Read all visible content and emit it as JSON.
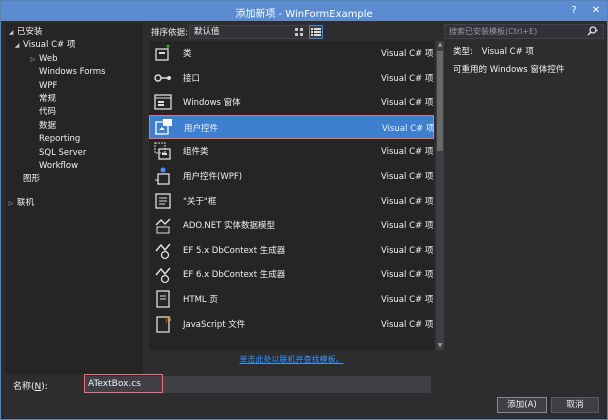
{
  "window": {
    "title": "添加新项 - WinFormExample",
    "help_glyph": "?",
    "close_glyph": "✕"
  },
  "tree": [
    {
      "label": "已安装",
      "level": 0,
      "expanded": true
    },
    {
      "label": "Visual C# 项",
      "level": 1,
      "expanded": true
    },
    {
      "label": "Web",
      "level": 2,
      "expanded": false
    },
    {
      "label": "Windows Forms",
      "level": 2,
      "expanded": null
    },
    {
      "label": "WPF",
      "level": 2,
      "expanded": null
    },
    {
      "label": "常规",
      "level": 2,
      "expanded": null
    },
    {
      "label": "代码",
      "level": 2,
      "expanded": null
    },
    {
      "label": "数据",
      "level": 2,
      "expanded": null
    },
    {
      "label": "Reporting",
      "level": 2,
      "expanded": null
    },
    {
      "label": "SQL Server",
      "level": 2,
      "expanded": null
    },
    {
      "label": "Workflow",
      "level": 2,
      "expanded": null
    },
    {
      "label": "图形",
      "level": 1,
      "expanded": null
    },
    {
      "label": "联机",
      "level": 0,
      "expanded": false
    }
  ],
  "toolbar": {
    "sort_label": "排序依据:",
    "sort_value": "默认值"
  },
  "search": {
    "placeholder": "搜索已安装模板(Ctrl+E)"
  },
  "items": [
    {
      "name": "类",
      "type": "Visual C# 项",
      "icon": "class-icon"
    },
    {
      "name": "接口",
      "type": "Visual C# 项",
      "icon": "interface-icon"
    },
    {
      "name": "Windows 窗体",
      "type": "Visual C# 项",
      "icon": "windows-form-icon"
    },
    {
      "name": "用户控件",
      "type": "Visual C# 项",
      "icon": "user-control-icon",
      "selected": true
    },
    {
      "name": "组件类",
      "type": "Visual C# 项",
      "icon": "component-class-icon"
    },
    {
      "name": "用户控件(WPF)",
      "type": "Visual C# 项",
      "icon": "wpf-user-control-icon"
    },
    {
      "name": "\"关于\"框",
      "type": "Visual C# 项",
      "icon": "about-box-icon"
    },
    {
      "name": "ADO.NET 实体数据模型",
      "type": "Visual C# 项",
      "icon": "entity-model-icon"
    },
    {
      "name": "EF 5.x DbContext 生成器",
      "type": "Visual C# 项",
      "icon": "dbcontext-generator-icon"
    },
    {
      "name": "EF 6.x DbContext 生成器",
      "type": "Visual C# 项",
      "icon": "dbcontext-generator-icon"
    },
    {
      "name": "HTML 页",
      "type": "Visual C# 项",
      "icon": "html-page-icon"
    },
    {
      "name": "JavaScript 文件",
      "type": "Visual C# 项",
      "icon": "javascript-file-icon"
    }
  ],
  "details": {
    "type_label": "类型:",
    "type_value": "Visual C# 项",
    "description": "可重用的 Windows 窗体控件"
  },
  "online_link": "单击此处以联机并查找模板。",
  "name_field": {
    "label": "名称(",
    "label_key": "N",
    "label_end": "):",
    "value": "ATextBox.cs"
  },
  "buttons": {
    "add": "添加(A)",
    "cancel": "取消"
  },
  "colors": {
    "accent": "#3e7fd0",
    "title_bar": "#5b8bd0",
    "highlight_border": "#f36d7c",
    "link": "#3794ff"
  }
}
